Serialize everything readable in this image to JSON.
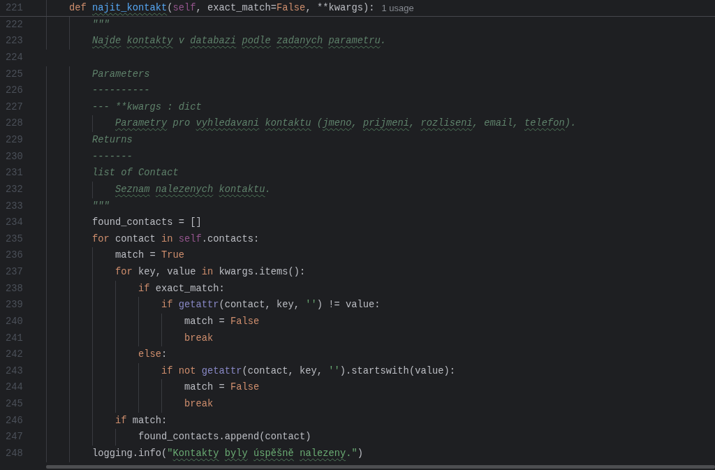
{
  "editor": {
    "lines": [
      {
        "number": "221",
        "sticky": true,
        "tokens": [
          {
            "text": "    def ",
            "kind": "kw"
          },
          {
            "text": "najit_kontakt",
            "kind": "fnt"
          },
          {
            "text": "(",
            "kind": "p"
          },
          {
            "text": "self",
            "kind": "self"
          },
          {
            "text": ", exact_match=",
            "kind": "p"
          },
          {
            "text": "False",
            "kind": "kw"
          },
          {
            "text": ", **kwargs):",
            "kind": "p"
          }
        ],
        "hint": "1 usage"
      },
      {
        "number": "222",
        "sticky": false,
        "tokens": [
          {
            "text": "        \"\"\"",
            "kind": "doc"
          }
        ]
      },
      {
        "number": "223",
        "sticky": false,
        "tokens": [
          {
            "text": "        Najde ",
            "kind": "doct"
          },
          {
            "text": "kontakty",
            "kind": "doct"
          },
          {
            "text": " v ",
            "kind": "doc"
          },
          {
            "text": "databazi ",
            "kind": "doct"
          },
          {
            "text": "podle ",
            "kind": "doct"
          },
          {
            "text": "zadanych ",
            "kind": "doct"
          },
          {
            "text": "parametru",
            "kind": "doct"
          },
          {
            "text": ".",
            "kind": "doc"
          }
        ]
      },
      {
        "number": "224"
      },
      {
        "number": "225",
        "sticky": false,
        "tokens": [
          {
            "text": "        Parameters",
            "kind": "doc"
          }
        ]
      },
      {
        "number": "226",
        "sticky": false,
        "tokens": [
          {
            "text": "        ----------",
            "kind": "doc"
          }
        ]
      },
      {
        "number": "227",
        "sticky": false,
        "tokens": [
          {
            "text": "        --- **kwargs : dict",
            "kind": "doc"
          }
        ]
      },
      {
        "number": "228",
        "sticky": false,
        "tokens": [
          {
            "text": "            Parametry",
            "kind": "doct"
          },
          {
            "text": " pro ",
            "kind": "doc"
          },
          {
            "text": "vyhledavani ",
            "kind": "doct"
          },
          {
            "text": "kontaktu",
            "kind": "doct"
          },
          {
            "text": " (",
            "kind": "doc"
          },
          {
            "text": "jmeno",
            "kind": "doct"
          },
          {
            "text": ", ",
            "kind": "doc"
          },
          {
            "text": "prijmeni",
            "kind": "doct"
          },
          {
            "text": ", ",
            "kind": "doc"
          },
          {
            "text": "rozliseni",
            "kind": "doct"
          },
          {
            "text": ", email, ",
            "kind": "doc"
          },
          {
            "text": "telefon",
            "kind": "doct"
          },
          {
            "text": ").",
            "kind": "doc"
          }
        ]
      },
      {
        "number": "229",
        "sticky": false,
        "tokens": [
          {
            "text": "        Returns",
            "kind": "doc"
          }
        ]
      },
      {
        "number": "230",
        "sticky": false,
        "tokens": [
          {
            "text": "        -------",
            "kind": "doc"
          }
        ]
      },
      {
        "number": "231",
        "sticky": false,
        "tokens": [
          {
            "text": "        list of Contact",
            "kind": "doc"
          }
        ]
      },
      {
        "number": "232",
        "sticky": false,
        "tokens": [
          {
            "text": "            Seznam ",
            "kind": "doct"
          },
          {
            "text": "nalezenych ",
            "kind": "doct"
          },
          {
            "text": "kontaktu",
            "kind": "doct"
          },
          {
            "text": ".",
            "kind": "doc"
          }
        ]
      },
      {
        "number": "233",
        "sticky": false,
        "tokens": [
          {
            "text": "        \"\"\"",
            "kind": "doc"
          }
        ]
      },
      {
        "number": "234",
        "sticky": false,
        "tokens": [
          {
            "text": "        found_contacts = []",
            "kind": "p"
          }
        ]
      },
      {
        "number": "235",
        "sticky": false,
        "tokens": [
          {
            "text": "        for",
            "kind": "kw"
          },
          {
            "text": " contact ",
            "kind": "p"
          },
          {
            "text": "in ",
            "kind": "kw"
          },
          {
            "text": "self",
            "kind": "self"
          },
          {
            "text": ".contacts:",
            "kind": "p"
          }
        ]
      },
      {
        "number": "236",
        "sticky": false,
        "tokens": [
          {
            "text": "            match = ",
            "kind": "p"
          },
          {
            "text": "True",
            "kind": "kw"
          }
        ]
      },
      {
        "number": "237",
        "sticky": false,
        "tokens": [
          {
            "text": "            for",
            "kind": "kw"
          },
          {
            "text": " key, value ",
            "kind": "p"
          },
          {
            "text": "in",
            "kind": "kw"
          },
          {
            "text": " kwargs.items():",
            "kind": "p"
          }
        ]
      },
      {
        "number": "238",
        "sticky": false,
        "tokens": [
          {
            "text": "                if",
            "kind": "kw"
          },
          {
            "text": " exact_match:",
            "kind": "p"
          }
        ]
      },
      {
        "number": "239",
        "sticky": false,
        "tokens": [
          {
            "text": "                    if ",
            "kind": "kw"
          },
          {
            "text": "getattr",
            "kind": "bi"
          },
          {
            "text": "(contact, key, ",
            "kind": "p"
          },
          {
            "text": "''",
            "kind": "str"
          },
          {
            "text": ") != value:",
            "kind": "p"
          }
        ]
      },
      {
        "number": "240",
        "sticky": false,
        "tokens": [
          {
            "text": "                        match = ",
            "kind": "p"
          },
          {
            "text": "False",
            "kind": "kw"
          }
        ]
      },
      {
        "number": "241",
        "sticky": false,
        "tokens": [
          {
            "text": "                        break",
            "kind": "kw"
          }
        ]
      },
      {
        "number": "242",
        "sticky": false,
        "tokens": [
          {
            "text": "                else",
            "kind": "kw"
          },
          {
            "text": ":",
            "kind": "p"
          }
        ]
      },
      {
        "number": "243",
        "sticky": false,
        "tokens": [
          {
            "text": "                    if not ",
            "kind": "kw"
          },
          {
            "text": "getattr",
            "kind": "bi"
          },
          {
            "text": "(contact, key, ",
            "kind": "p"
          },
          {
            "text": "''",
            "kind": "str"
          },
          {
            "text": ").startswith(value):",
            "kind": "p"
          }
        ]
      },
      {
        "number": "244",
        "sticky": false,
        "tokens": [
          {
            "text": "                        match = ",
            "kind": "p"
          },
          {
            "text": "False",
            "kind": "kw"
          }
        ]
      },
      {
        "number": "245",
        "sticky": false,
        "tokens": [
          {
            "text": "                        break",
            "kind": "kw"
          }
        ]
      },
      {
        "number": "246",
        "sticky": false,
        "tokens": [
          {
            "text": "            if",
            "kind": "kw"
          },
          {
            "text": " match:",
            "kind": "p"
          }
        ]
      },
      {
        "number": "247",
        "sticky": false,
        "tokens": [
          {
            "text": "                found_contacts.append(contact)",
            "kind": "p"
          }
        ]
      },
      {
        "number": "248",
        "sticky": false,
        "tokens": [
          {
            "text": "        logging.info(",
            "kind": "p"
          },
          {
            "text": "\"",
            "kind": "str"
          },
          {
            "text": "Kontakty ",
            "kind": "strt"
          },
          {
            "text": "byly ",
            "kind": "strt"
          },
          {
            "text": "úspěšně ",
            "kind": "strt"
          },
          {
            "text": "nalezeny",
            "kind": "strt"
          },
          {
            "text": ".\"",
            "kind": "str"
          },
          {
            "text": ")",
            "kind": "p"
          }
        ]
      }
    ]
  }
}
